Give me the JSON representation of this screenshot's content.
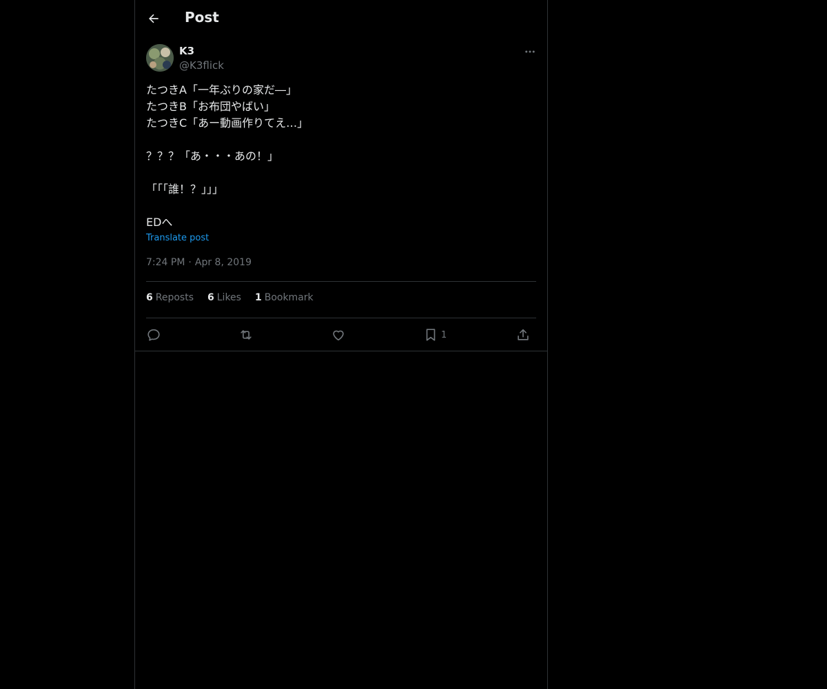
{
  "header": {
    "title": "Post"
  },
  "post": {
    "author_name": "K3",
    "author_handle": "@K3flick",
    "lines": [
      "たつきA「一年ぶりの家だ―」",
      "たつきB「お布団やばい」",
      "たつきC「あー動画作りてえ…」",
      "",
      "？？？「あ・・・あの！」",
      "",
      "「「「誰！？」」」",
      "",
      "EDへ"
    ],
    "translate_label": "Translate post",
    "time": "7:24 PM",
    "date": "Apr 8, 2019",
    "stats": {
      "reposts_count": "6",
      "reposts_label": "Reposts",
      "likes_count": "6",
      "likes_label": "Likes",
      "bookmarks_count": "1",
      "bookmarks_label": "Bookmark"
    },
    "actions": {
      "bookmark_count": "1"
    }
  },
  "icons": [
    "back-arrow-icon",
    "more-icon",
    "reply-icon",
    "repost-icon",
    "like-icon",
    "bookmark-icon",
    "share-icon"
  ],
  "colors": {
    "background": "#000000",
    "text": "#e7e9ea",
    "secondary": "#71767b",
    "link": "#1d9bf0",
    "border": "#2f3336"
  }
}
